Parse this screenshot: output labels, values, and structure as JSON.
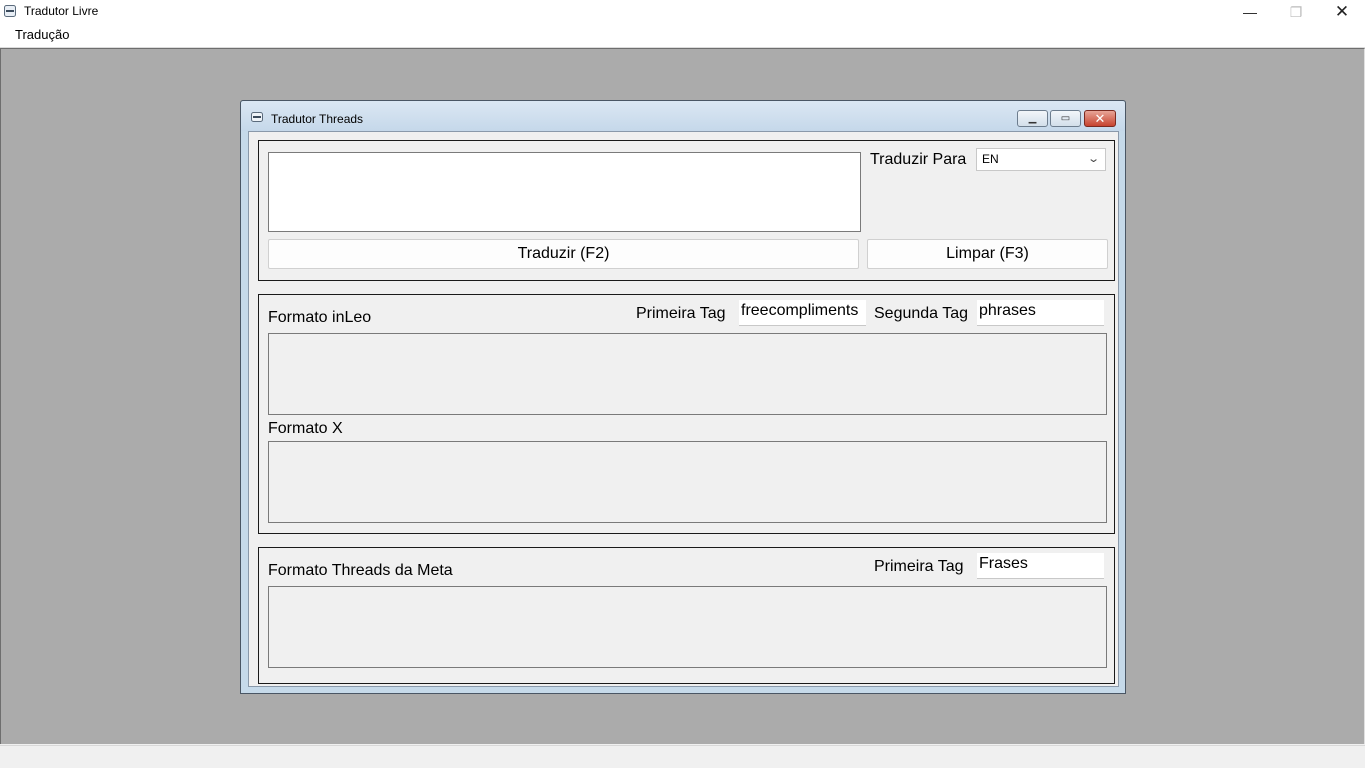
{
  "app": {
    "title": "Tradutor Livre",
    "window_buttons": {
      "minimize": "—",
      "maximize": "❐",
      "close": "✕"
    }
  },
  "menu": {
    "items": [
      "Tradução"
    ]
  },
  "child": {
    "title": "Tradutor Threads",
    "buttons": {
      "minimize": "▁",
      "restore": "▭",
      "close": "✕"
    }
  },
  "translate_section": {
    "source_text": "",
    "target_label": "Traduzir Para",
    "target_language": "EN",
    "translate_button": "Traduzir (F2)",
    "clear_button": "Limpar (F3)"
  },
  "inleo_section": {
    "inleo_label": "Formato inLeo",
    "first_tag_label": "Primeira Tag",
    "first_tag_value": "freecompliments",
    "second_tag_label": "Segunda Tag",
    "second_tag_value": "phrases",
    "inleo_output": "",
    "x_label": "Formato X",
    "x_output": ""
  },
  "threads_section": {
    "label": "Formato Threads da Meta",
    "first_tag_label": "Primeira Tag",
    "first_tag_value": "Frases",
    "output": ""
  }
}
